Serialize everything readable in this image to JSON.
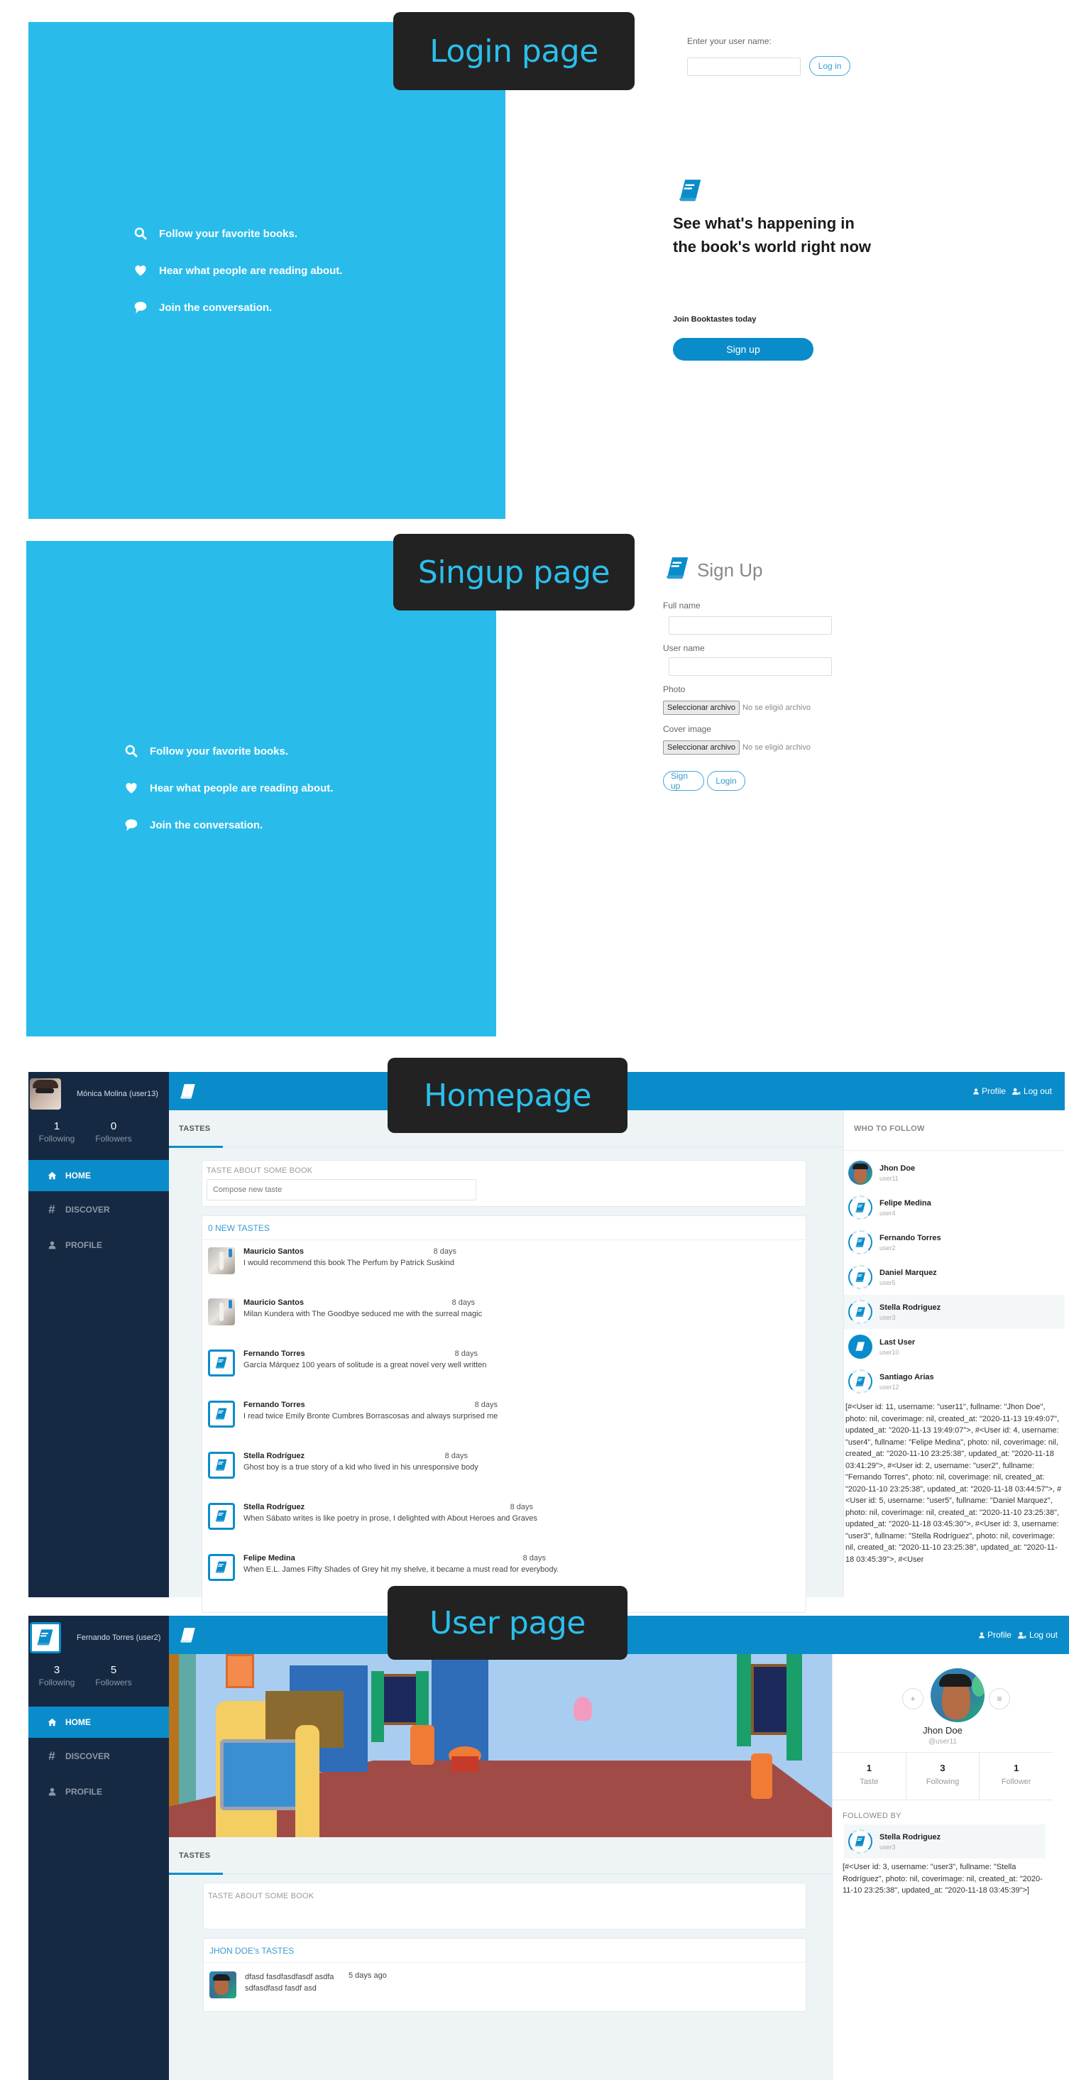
{
  "colors": {
    "hero_blue": "#29bcea",
    "brand_blue": "#0a8ccb",
    "sidebar_navy": "#152942",
    "callout_bg": "#222222",
    "callout_text": "#2bbfec"
  },
  "callouts": {
    "login": "Login page",
    "signup": "Singup page",
    "home": "Homepage",
    "user": "User page"
  },
  "hero_features": [
    {
      "icon": "search-icon",
      "text": "Follow your favorite books."
    },
    {
      "icon": "heart-icon",
      "text": "Hear what people are reading about."
    },
    {
      "icon": "speech-bubble-icon",
      "text": "Join the conversation."
    }
  ],
  "login": {
    "username_label": "Enter your user name:",
    "username_value": "",
    "login_button": "Log in",
    "headline": "See what's happening in the book's world right now",
    "join_text": "Join Booktastes today",
    "signup_button": "Sign up"
  },
  "signup": {
    "title": "Sign Up",
    "fullname_label": "Full name",
    "fullname_value": "",
    "username_label": "User name",
    "username_value": "",
    "photo_label": "Photo",
    "cover_label": "Cover image",
    "file_button": "Seleccionar archivo",
    "file_none": "No se eligió archivo",
    "signup_button": "Sign up",
    "login_button": "Login"
  },
  "nav": {
    "home": "HOME",
    "discover": "DISCOVER",
    "profile": "PROFILE",
    "following_label": "Following",
    "followers_label": "Followers",
    "top_profile": "Profile",
    "top_logout": "Log out",
    "tab_tastes": "TASTES"
  },
  "home": {
    "current_user": "Mónica Molina (user13)",
    "following": "1",
    "followers": "0",
    "compose_label": "TASTE ABOUT SOME BOOK",
    "compose_placeholder": "Compose new taste",
    "new_tastes": "0 NEW TASTES",
    "tastes": [
      {
        "author": "Mauricio Santos",
        "date": "8 days",
        "text": "I would recommend this book The Perfum by Patrick Suskind",
        "avatar": "book-photo"
      },
      {
        "author": "Mauricio Santos",
        "date": "8 days",
        "text": "Milan Kundera with The Goodbye seduced me with the surreal magic",
        "avatar": "book-photo"
      },
      {
        "author": "Fernando Torres",
        "date": "8 days",
        "text": "García Márquez 100 years of solitude is a great novel very well written",
        "avatar": "book-icon"
      },
      {
        "author": "Fernando Torres",
        "date": "8 days",
        "text": "I read twice Emily Bronte Cumbres Borrascosas and always surprised me",
        "avatar": "book-icon"
      },
      {
        "author": "Stella Rodríguez",
        "date": "8 days",
        "text": "Ghost boy is a true story of a kid who lived in his unresponsive body",
        "avatar": "book-icon"
      },
      {
        "author": "Stella Rodríguez",
        "date": "8 days",
        "text": "When Sábato writes is like poetry in prose, I delighted with About Heroes and Graves",
        "avatar": "book-icon"
      },
      {
        "author": "Felipe Medina",
        "date": "8 days",
        "text": "When E.L. James Fifty Shades of Grey hit my shelve, it became a must read for everybody.",
        "avatar": "book-icon"
      }
    ],
    "who_to_follow_title": "WHO TO FOLLOW",
    "who_to_follow": [
      {
        "name": "Jhon Doe",
        "username": "user11",
        "avatar": "photo"
      },
      {
        "name": "Felipe Medina",
        "username": "user4",
        "avatar": "book-icon"
      },
      {
        "name": "Fernando Torres",
        "username": "user2",
        "avatar": "book-icon"
      },
      {
        "name": "Daniel Marquez",
        "username": "user5",
        "avatar": "book-icon"
      },
      {
        "name": "Stella Rodriguez",
        "username": "user3",
        "avatar": "book-icon"
      },
      {
        "name": "Last User",
        "username": "user10",
        "avatar": "book-icon-solid"
      },
      {
        "name": "Santiago Arias",
        "username": "user12",
        "avatar": "book-icon"
      }
    ],
    "debug_dump": "[#<User id: 11, username: \"user11\", fullname: \"Jhon Doe\", photo: nil, coverimage: nil, created_at: \"2020-11-13 19:49:07\", updated_at: \"2020-11-13 19:49:07\">, #<User id: 4, username: \"user4\", fullname: \"Felipe Medina\", photo: nil, coverimage: nil, created_at: \"2020-11-10 23:25:38\", updated_at: \"2020-11-18 03:41:29\">, #<User id: 2, username: \"user2\", fullname: \"Fernando Torres\", photo: nil, coverimage: nil, created_at: \"2020-11-10 23:25:38\", updated_at: \"2020-11-18 03:44:57\">, #<User id: 5, username: \"user5\", fullname: \"Daniel Marquez\", photo: nil, coverimage: nil, created_at: \"2020-11-10 23:25:38\", updated_at: \"2020-11-18 03:45:30\">, #<User id: 3, username: \"user3\", fullname: \"Stella Rodríguez\", photo: nil, coverimage: nil, created_at: \"2020-11-10 23:25:38\", updated_at: \"2020-11-18 03:45:39\">, #<User"
  },
  "userpage": {
    "current_user": "Fernando Torres (user2)",
    "following": "3",
    "followers": "5",
    "compose_label": "TASTE ABOUT SOME BOOK",
    "tastes_title": "JHON DOE's TASTES",
    "taste": {
      "text": "dfasd fasdfasdfasdf asdfa sdfasdfasd fasdf asd",
      "date": "5 days ago"
    },
    "profile_name": "Jhon Doe",
    "profile_handle": "@user11",
    "follow_btn": "+",
    "menu_btn": "≡",
    "stats": [
      {
        "value": "1",
        "label": "Taste"
      },
      {
        "value": "3",
        "label": "Following"
      },
      {
        "value": "1",
        "label": "Follower"
      }
    ],
    "followed_by_title": "FOLLOWED BY",
    "followed_by": [
      {
        "name": "Stella Rodriguez",
        "username": "user3"
      }
    ],
    "debug_dump": "[#<User id: 3, username: \"user3\", fullname: \"Stella Rodríguez\", photo: nil, coverimage: nil, created_at: \"2020-11-10 23:25:38\", updated_at: \"2020-11-18 03:45:39\">]"
  }
}
